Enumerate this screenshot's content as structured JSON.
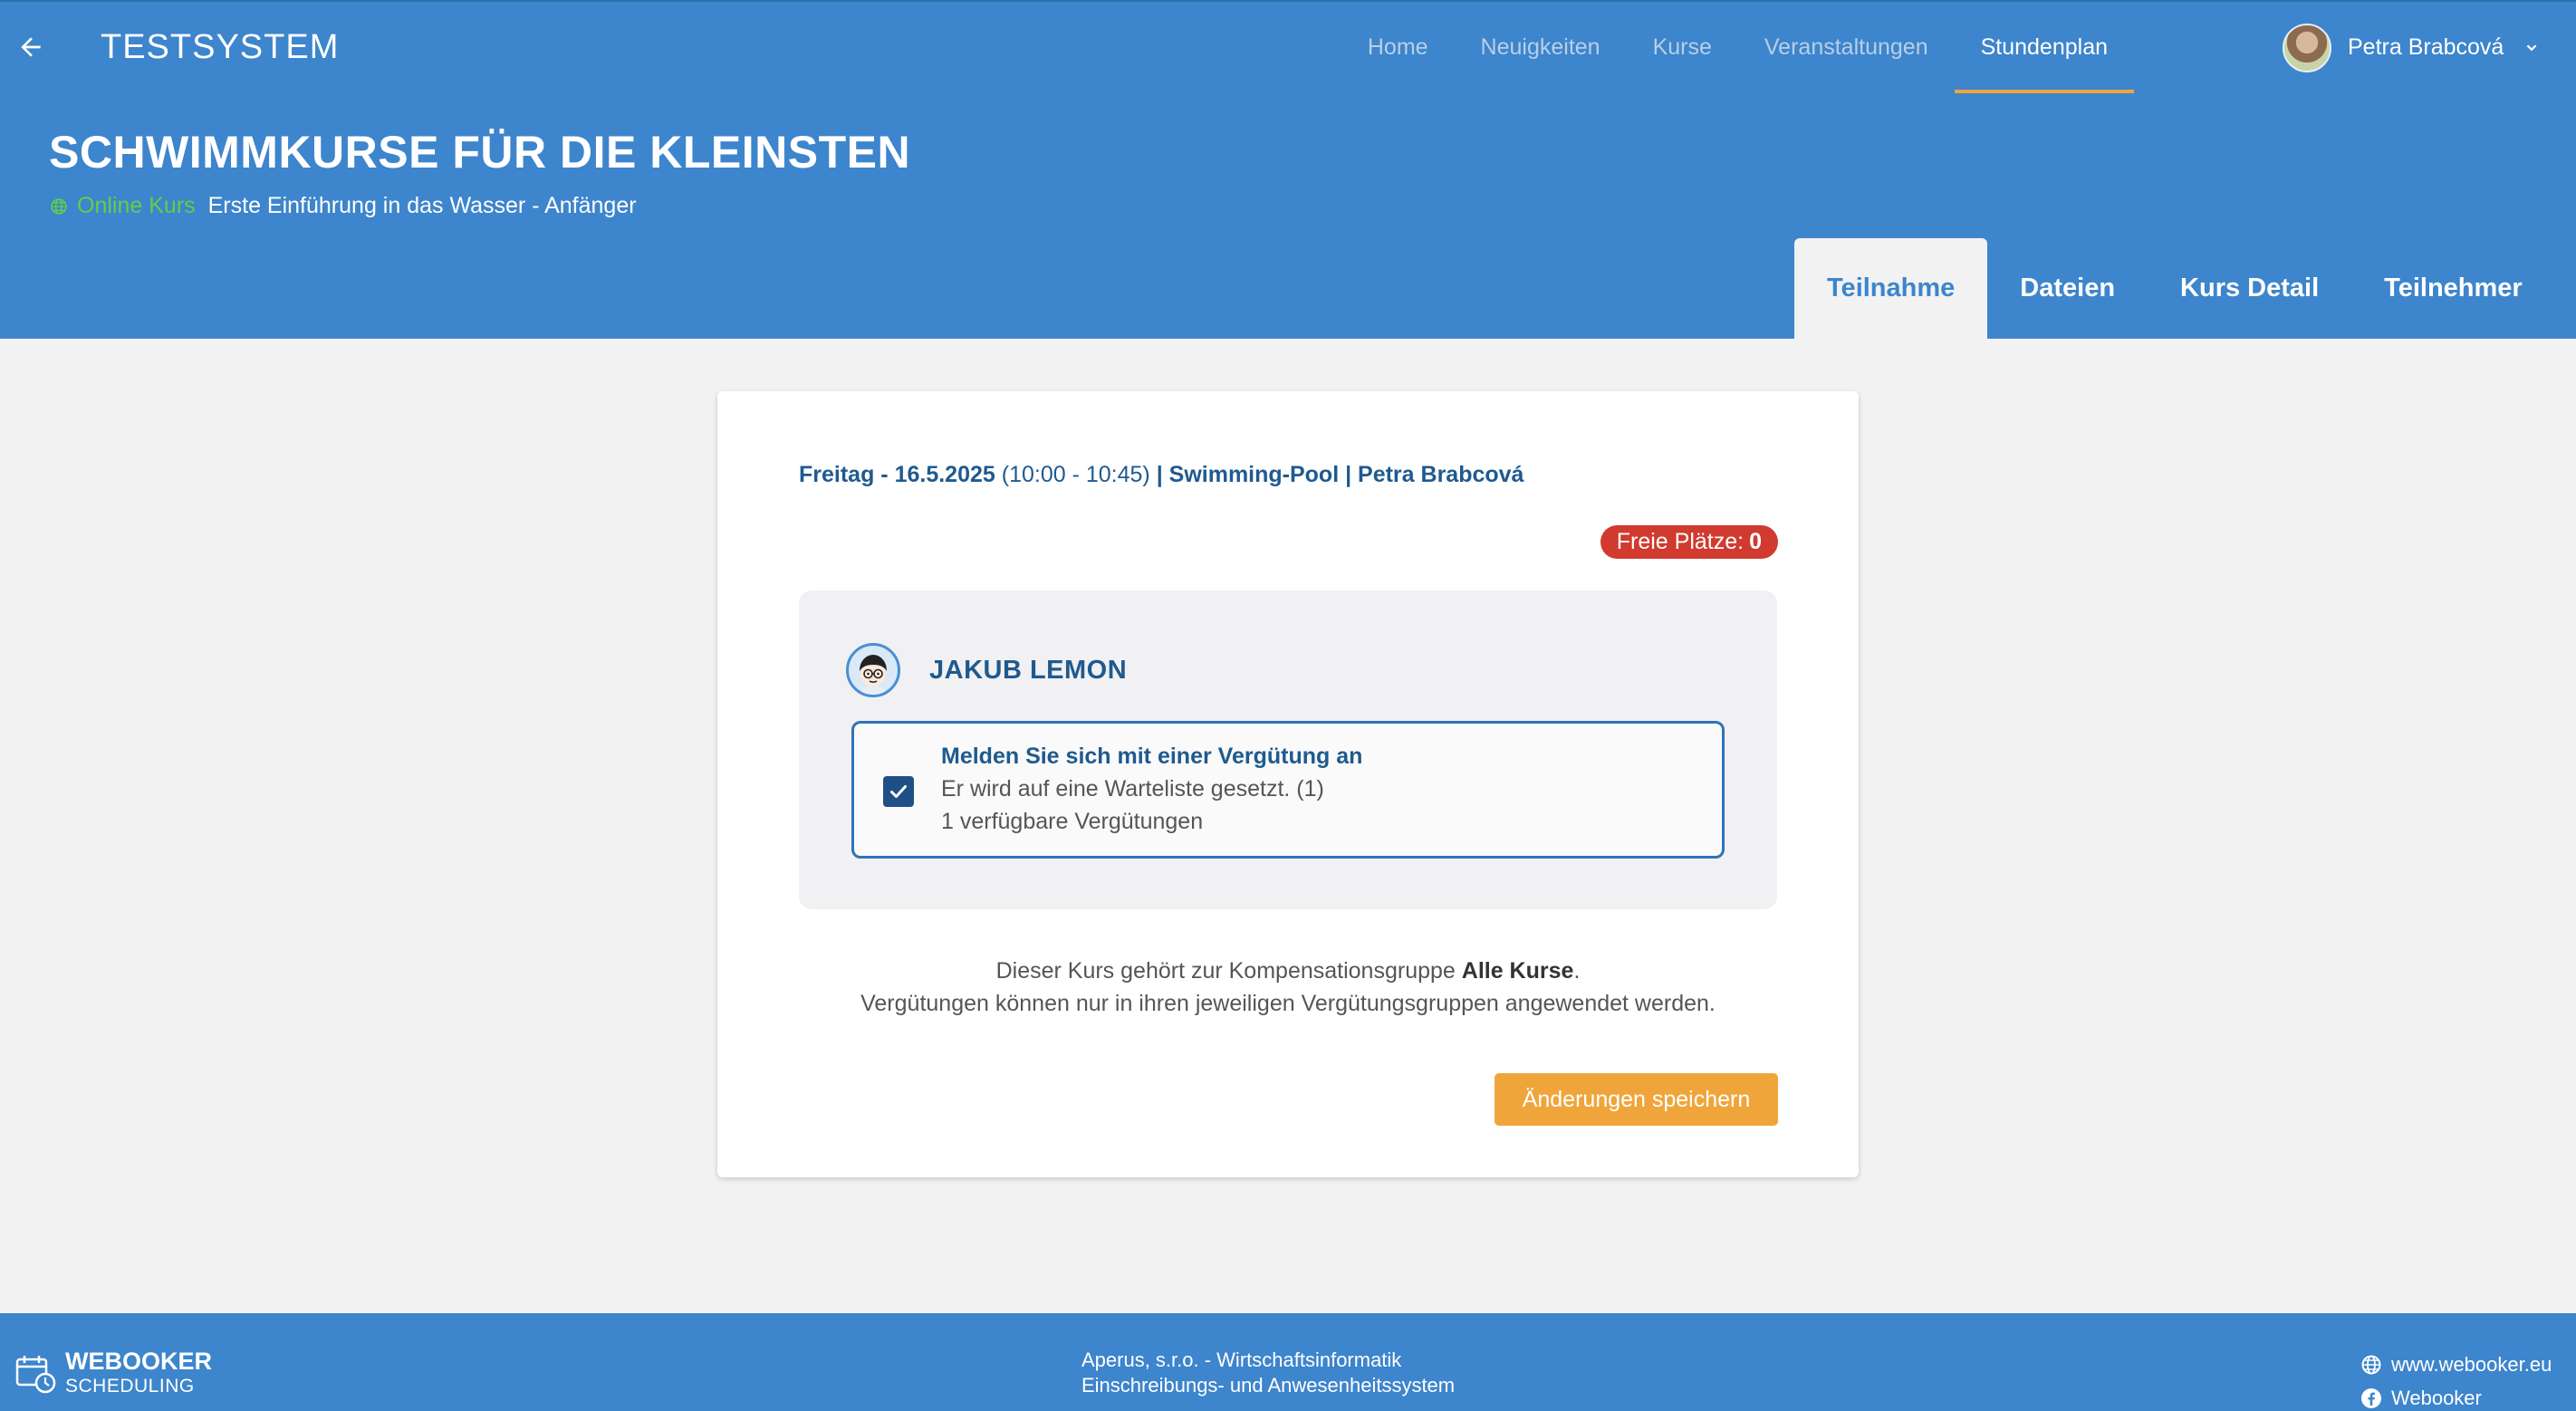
{
  "header": {
    "app_title": "TESTSYSTEM",
    "nav": [
      "Home",
      "Neuigkeiten",
      "Kurse",
      "Veranstaltungen",
      "Stundenplan"
    ],
    "active_nav": "Stundenplan",
    "user_name": "Petra Brabcová"
  },
  "course": {
    "title": "SCHWIMMKURSE FÜR DIE KLEINSTEN",
    "online_label": "Online Kurs",
    "description": "Erste Einführung in das Wasser - Anfänger",
    "tabs": [
      "Teilnahme",
      "Dateien",
      "Kurs Detail",
      "Teilnehmer"
    ],
    "active_tab": "Teilnahme"
  },
  "session": {
    "date": "Freitag - 16.5.2025",
    "time": "(10:00 - 10:45)",
    "location_trainer": "| Swimming-Pool | Petra Brabcová",
    "free_label": "Freie Plätze:",
    "free_count": "0"
  },
  "participant": {
    "name": "JAKUB LEMON",
    "option_title": "Melden Sie sich mit einer Vergütung an",
    "option_line1": "Er wird auf eine Warteliste gesetzt. (1)",
    "option_line2": "1 verfügbare Vergütungen",
    "checked": true
  },
  "compensation": {
    "line1_prefix": "Dieser Kurs gehört zur Kompensationsgruppe",
    "group": "Alle Kurse",
    "line1_suffix": ".",
    "line2": "Vergütungen können nur in ihren jeweiligen Vergütungsgruppen angewendet werden."
  },
  "save_label": "Änderungen speichern",
  "footer": {
    "brand_line1": "WEBOOKER",
    "brand_line2": "SCHEDULING",
    "company_line1": "Aperus, s.r.o. - Wirtschaftsinformatik",
    "company_line2": "Einschreibungs- und Anwesenheitssystem",
    "website": "www.webooker.eu",
    "facebook": "Webooker"
  },
  "colors": {
    "primary": "#3d85cc",
    "accent": "#f0a53b",
    "danger": "#d13a2f",
    "online": "#5fcf4a",
    "text_dark_blue": "#1f5a8f"
  }
}
